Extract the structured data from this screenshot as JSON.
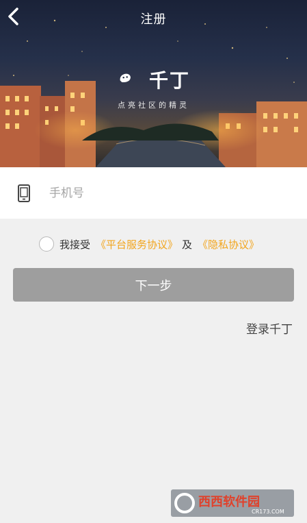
{
  "header": {
    "title": "注册"
  },
  "brand": {
    "name": "千丁",
    "slogan": "点亮社区的精灵"
  },
  "form": {
    "phone_placeholder": "手机号"
  },
  "agreement": {
    "prefix": "我接受",
    "platform_link": "《平台服务协议》",
    "and": "及",
    "privacy_link": "《隐私协议》"
  },
  "actions": {
    "next_label": "下一步",
    "login_label": "登录千丁"
  },
  "watermark": {
    "site": "西西软件园",
    "url": "CR173.COM"
  },
  "colors": {
    "accent": "#f2a51d",
    "button": "#9e9e9e",
    "background": "#f0f0f0"
  }
}
